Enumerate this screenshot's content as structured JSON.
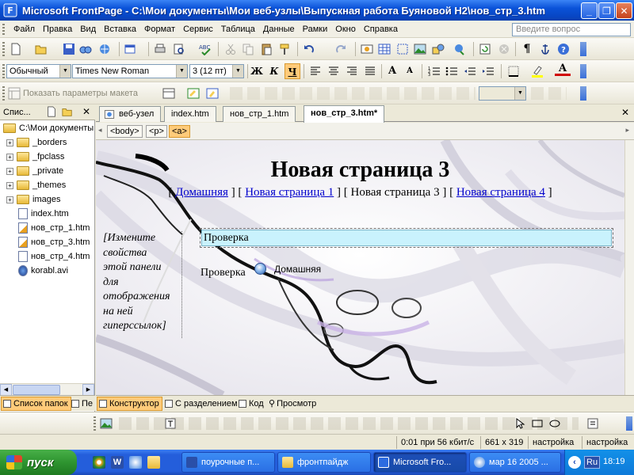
{
  "window": {
    "title": "Microsoft FrontPage - C:\\Мои документы\\Мои веб-узлы\\Выпускная работа Буяновой Н2\\нов_стр_3.htm"
  },
  "menu": [
    "Файл",
    "Правка",
    "Вид",
    "Вставка",
    "Формат",
    "Сервис",
    "Таблица",
    "Данные",
    "Рамки",
    "Окно",
    "Справка"
  ],
  "help_box": {
    "placeholder": "Введите вопрос"
  },
  "format_toolbar": {
    "style": "Обычный",
    "font": "Times New Roman",
    "size": "3  (12 пт)",
    "bold": "Ж",
    "italic": "К",
    "underline": "Ч"
  },
  "layout_toolbar": {
    "label": "Показать параметры макета"
  },
  "folder_pane": {
    "title": "Спис...",
    "items": [
      {
        "label": "C:\\Мои документы",
        "type": "root"
      },
      {
        "label": "_borders",
        "type": "folder"
      },
      {
        "label": "_fpclass",
        "type": "folder"
      },
      {
        "label": "_private",
        "type": "folder"
      },
      {
        "label": "_themes",
        "type": "folder"
      },
      {
        "label": "images",
        "type": "folder"
      },
      {
        "label": "index.htm",
        "type": "file"
      },
      {
        "label": "нов_стр_1.htm",
        "type": "file"
      },
      {
        "label": "нов_стр_3.htm",
        "type": "file"
      },
      {
        "label": "нов_стр_4.htm",
        "type": "file"
      },
      {
        "label": "korabl.avi",
        "type": "file"
      }
    ]
  },
  "doc_tabs": [
    "веб-узел",
    "index.htm",
    "нов_стр_1.htm",
    "нов_стр_3.htm*"
  ],
  "tag_selector": [
    "<body>",
    "<p>",
    "<a>"
  ],
  "page": {
    "heading": "Новая страница 3",
    "nav": {
      "open": "[ ",
      "sep": " ] [ ",
      "close": " ]",
      "links": [
        "Домашняя",
        "Новая страница 1",
        "Новая страница 3",
        "Новая страница 4"
      ]
    },
    "sidebar_lines": [
      "[Измените",
      "свойства",
      "этой панели",
      "для",
      "отображения",
      "на ней",
      "гиперссылок]"
    ],
    "check_box_text": "Проверка",
    "check_text": "Проверка",
    "home_button_label": "Домашняя"
  },
  "folder_tabs": [
    "Список папок",
    "Пе"
  ],
  "view_tabs": [
    "Конструктор",
    "С разделением",
    "Код",
    "Просмотр"
  ],
  "status": {
    "speed": "0:01 при 56 кбит/с",
    "dims": "661 x 319",
    "mode1": "настройка",
    "mode2": "настройка"
  },
  "taskbar": {
    "start": "пуск",
    "tasks": [
      "поурочные п...",
      "фронтпайдж",
      "Microsoft Fro...",
      "мар 16 2005 ..."
    ],
    "lang": "Ru",
    "clock": "18:19"
  },
  "colors": {
    "titlebar": "#0a52d8",
    "selection_box": "#c9f2fd",
    "active_tab": "#ffcb7a",
    "link": "#0000cc"
  }
}
